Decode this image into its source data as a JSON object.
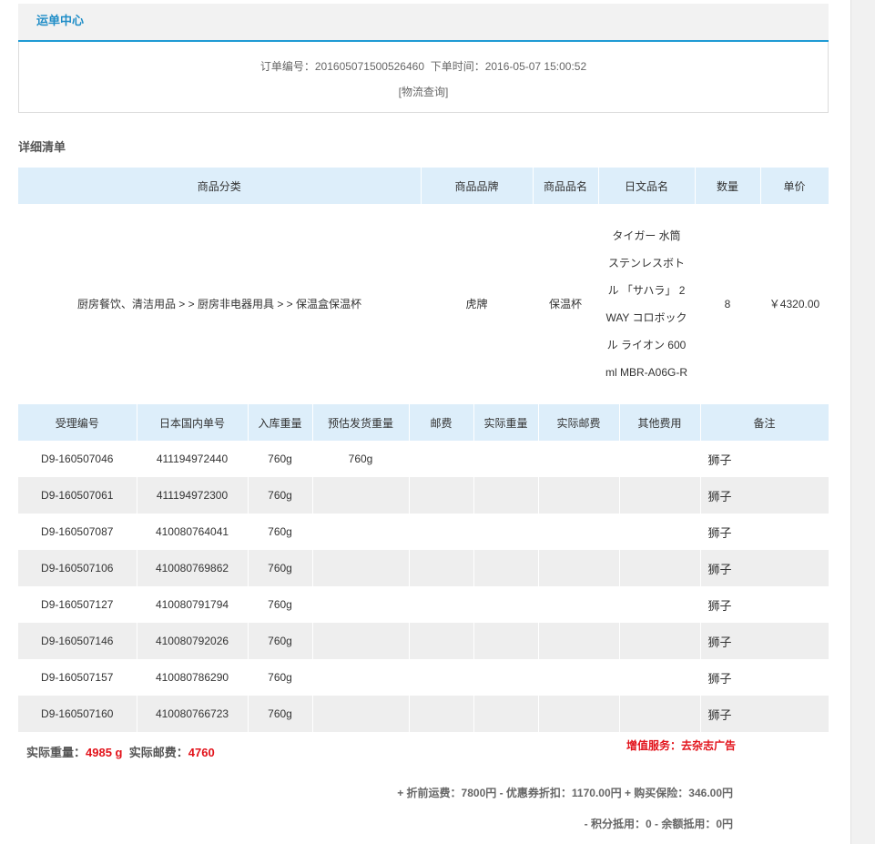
{
  "header": {
    "title": "运单中心"
  },
  "order": {
    "number_label": "订单编号：",
    "number": "201605071500526460",
    "time_label": "下单时间：",
    "time": "2016-05-07 15:00:52",
    "logistics_link": "[物流查询]"
  },
  "detail_title": "详细清单",
  "goods_table": {
    "headers": [
      "商品分类",
      "商品品牌",
      "商品品名",
      "日文品名",
      "数量",
      "单价"
    ],
    "rows": [
      {
        "category": "厨房餐饮、清洁用品 > > 厨房非电器用具 > > 保温盒保温杯",
        "brand": "虎牌",
        "name": "保温杯",
        "jp_name": "タイガー 水筒 ステンレスボトル 「サハラ」 2WAY コロボックル ライオン 600ml MBR-A06G-R",
        "qty": "8",
        "price": "￥4320.00"
      }
    ]
  },
  "package_table": {
    "headers": [
      "受理编号",
      "日本国内单号",
      "入库重量",
      "预估发货重量",
      "邮费",
      "实际重量",
      "实际邮费",
      "其他费用",
      "备注"
    ],
    "rows": [
      {
        "id": "D9-160507046",
        "jp_no": "411194972440",
        "in_weight": "760g",
        "est_weight": "760g",
        "postage": "",
        "actual_weight": "",
        "actual_postage": "",
        "other": "",
        "note": "狮子"
      },
      {
        "id": "D9-160507061",
        "jp_no": "411194972300",
        "in_weight": "760g",
        "est_weight": "",
        "postage": "",
        "actual_weight": "",
        "actual_postage": "",
        "other": "",
        "note": "狮子"
      },
      {
        "id": "D9-160507087",
        "jp_no": "410080764041",
        "in_weight": "760g",
        "est_weight": "",
        "postage": "",
        "actual_weight": "",
        "actual_postage": "",
        "other": "",
        "note": "狮子"
      },
      {
        "id": "D9-160507106",
        "jp_no": "410080769862",
        "in_weight": "760g",
        "est_weight": "",
        "postage": "",
        "actual_weight": "",
        "actual_postage": "",
        "other": "",
        "note": "狮子"
      },
      {
        "id": "D9-160507127",
        "jp_no": "410080791794",
        "in_weight": "760g",
        "est_weight": "",
        "postage": "",
        "actual_weight": "",
        "actual_postage": "",
        "other": "",
        "note": "狮子"
      },
      {
        "id": "D9-160507146",
        "jp_no": "410080792026",
        "in_weight": "760g",
        "est_weight": "",
        "postage": "",
        "actual_weight": "",
        "actual_postage": "",
        "other": "",
        "note": "狮子"
      },
      {
        "id": "D9-160507157",
        "jp_no": "410080786290",
        "in_weight": "760g",
        "est_weight": "",
        "postage": "",
        "actual_weight": "",
        "actual_postage": "",
        "other": "",
        "note": "狮子"
      },
      {
        "id": "D9-160507160",
        "jp_no": "410080766723",
        "in_weight": "760g",
        "est_weight": "",
        "postage": "",
        "actual_weight": "",
        "actual_postage": "",
        "other": "",
        "note": "狮子"
      }
    ]
  },
  "summary": {
    "actual_weight_label": "实际重量：",
    "actual_weight": "4985 g",
    "actual_postage_label": "实际邮费：",
    "actual_postage": "4760",
    "value_added": "增值服务：去杂志广告"
  },
  "fees": {
    "line1": "+ 折前运费：7800円 - 优惠券折扣：1170.00円 + 购买保险：346.00円",
    "line2": "- 积分抵用：0 - 余额抵用：0円"
  },
  "colors": {
    "accent": "#1f9bd4",
    "header_bg": "#ddeefa",
    "alt_row": "#eeeeee",
    "highlight_red": "#e2131b"
  }
}
